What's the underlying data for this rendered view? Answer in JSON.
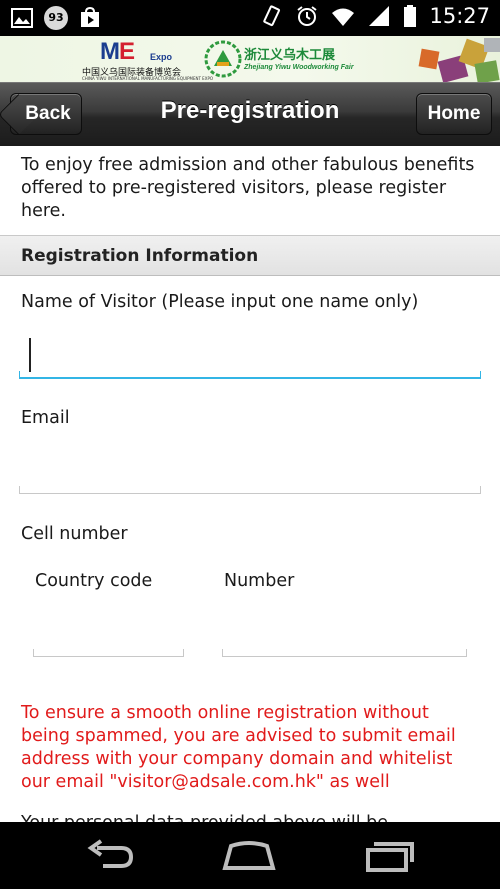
{
  "status_bar": {
    "notification_count": "93",
    "time": "15:27",
    "icons": [
      "image-icon",
      "notification-count-icon",
      "play-store-icon",
      "vibrate-icon",
      "alarm-icon",
      "wifi-icon",
      "signal-icon",
      "battery-icon"
    ]
  },
  "banner": {
    "me_logo": {
      "letters_blue": "M",
      "letters_red": "E",
      "expo": "Expo",
      "cn": "中国义乌国际装备博览会",
      "en": "CHINA YIWU INTERNATIONAL MANUFACTURING EQUIPMENT EXPO"
    },
    "yiwu_logo": {
      "cn": "浙江义乌木工展",
      "en": "Zhejiang Yiwu Woodworking Fair"
    }
  },
  "navbar": {
    "back_label": "Back",
    "title": "Pre-registration",
    "home_label": "Home"
  },
  "form": {
    "intro": "To enjoy free admission and other fabulous benefits offered to pre-registered visitors, please register here.",
    "section_title": "Registration Information",
    "name_label": "Name of Visitor (Please input one name only)",
    "name_value": "",
    "email_label": "Email",
    "email_value": "",
    "cell_label": "Cell number",
    "country_code_label": "Country code",
    "country_code_value": "",
    "number_label": "Number",
    "number_value": "",
    "warning": "To ensure a smooth online registration without being spammed, you are advised to submit email address with your company domain and whitelist our email \"visitor@adsale.com.hk\" as well",
    "next_text_partial": "Your personal data provided above will be..."
  },
  "colors": {
    "accent": "#33b5e5",
    "warning": "#e11b1b",
    "navbar": "#2b2b2b"
  },
  "system_nav": [
    "back-icon",
    "home-icon",
    "recent-apps-icon"
  ]
}
